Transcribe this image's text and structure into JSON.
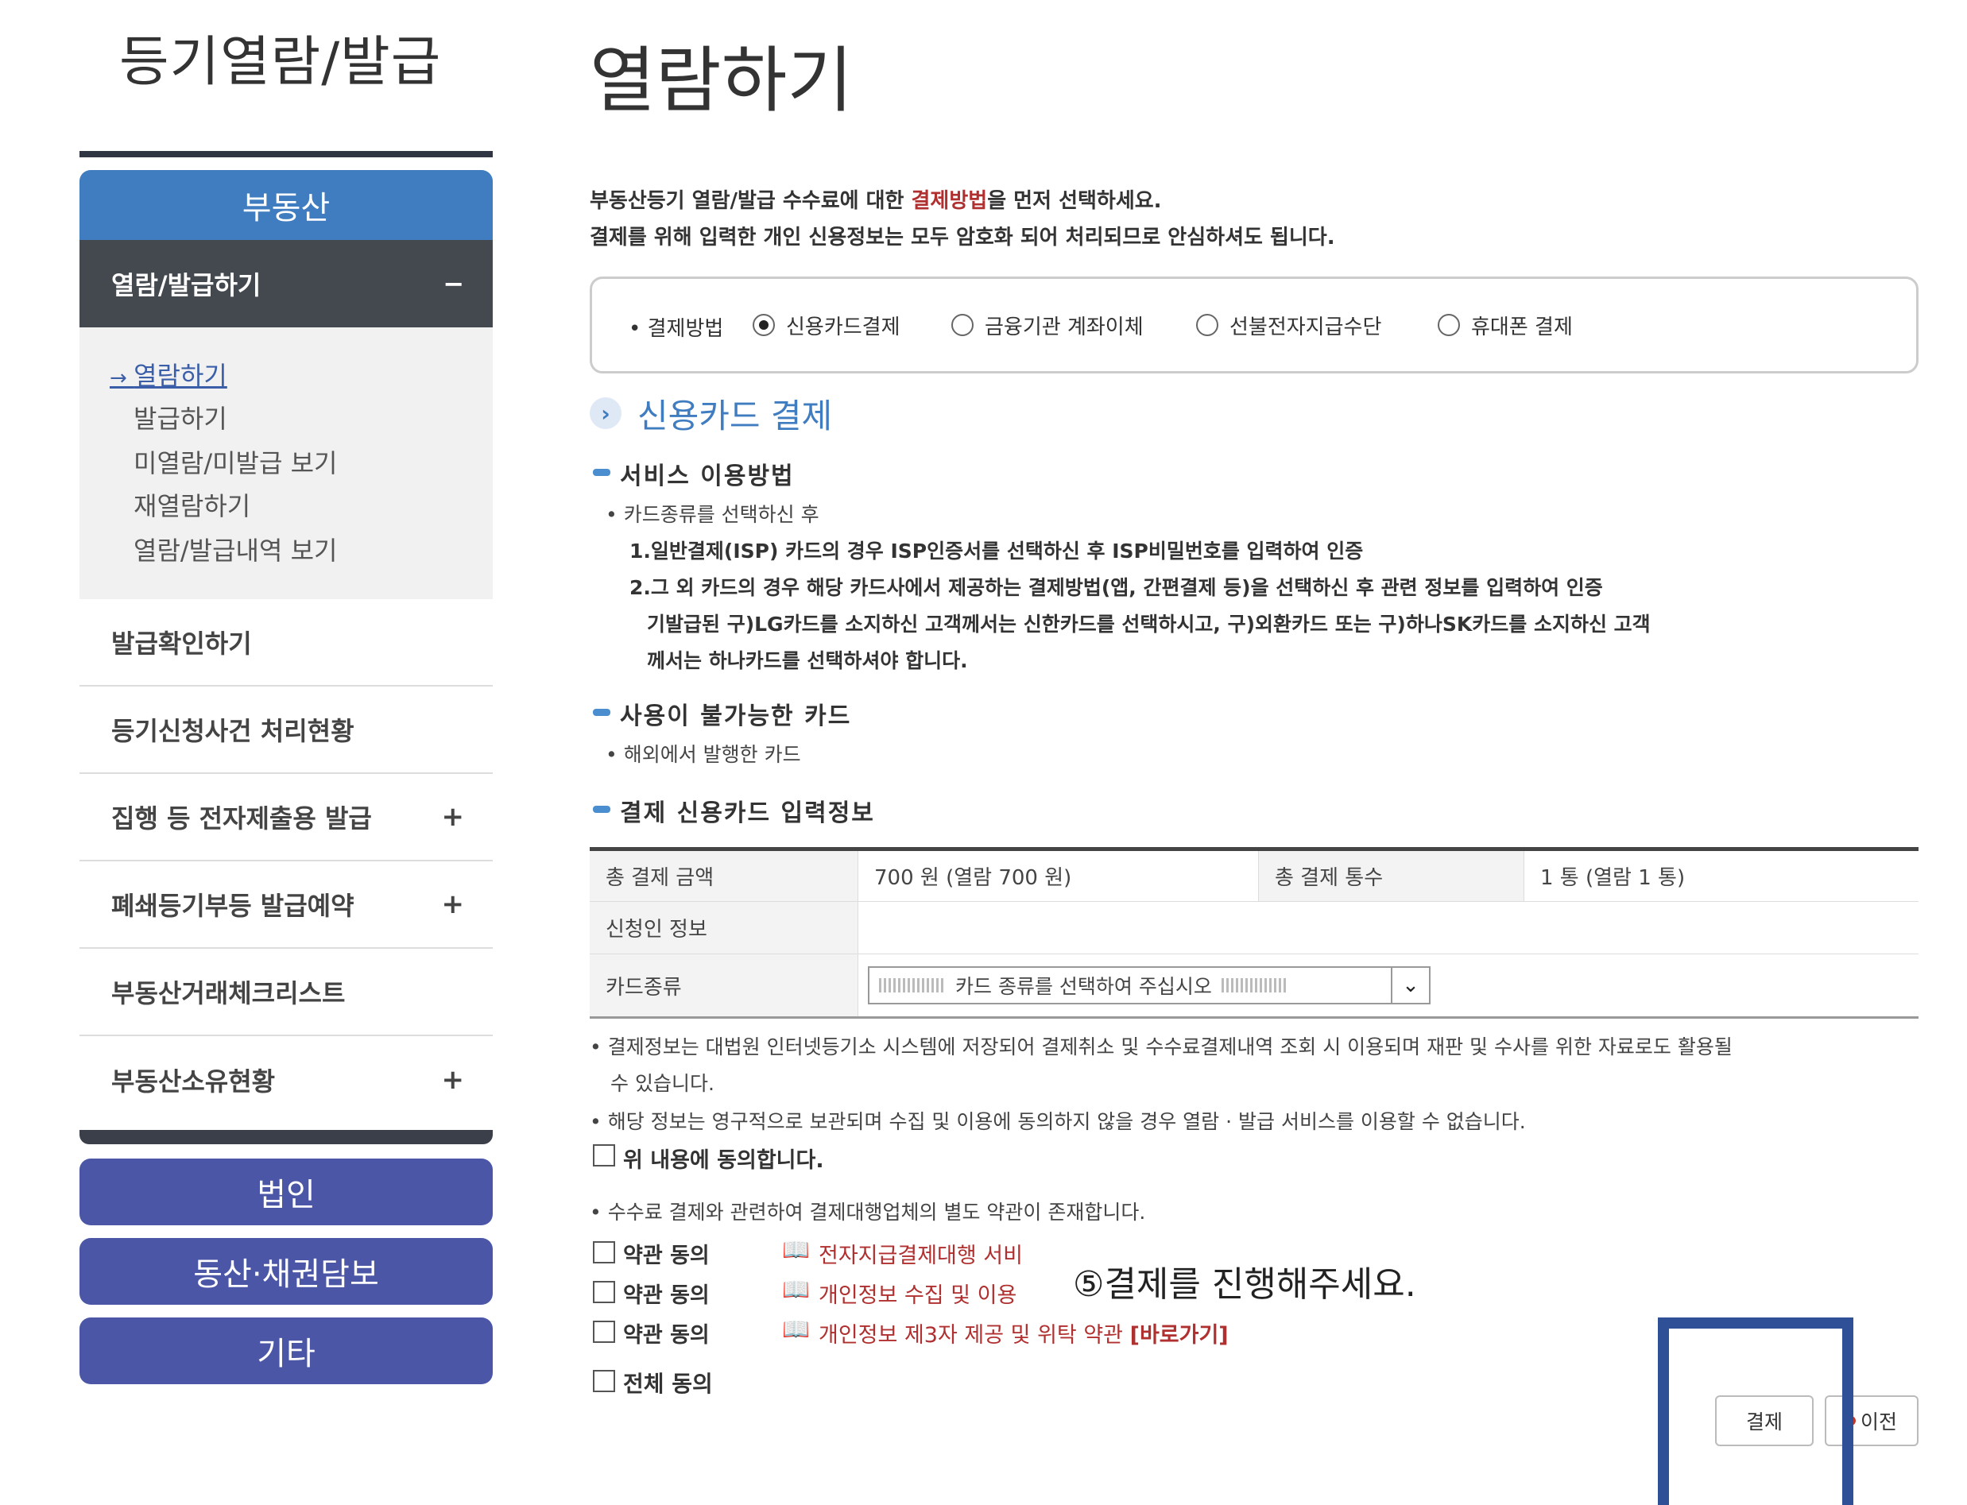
{
  "sidebar": {
    "title": "등기열람/발급",
    "section_header": "부동산",
    "open_menu": {
      "label": "열람/발급하기",
      "toggle": "−"
    },
    "sub_items": [
      "열람하기",
      "발급하기",
      "미열람/미발급 보기",
      "재열람하기",
      "열람/발급내역 보기"
    ],
    "rows": [
      {
        "label": "발급확인하기",
        "plus": ""
      },
      {
        "label": "등기신청사건 처리현황",
        "plus": ""
      },
      {
        "label": "집행 등 전자제출용 발급",
        "plus": "+"
      },
      {
        "label": "폐쇄등기부등 발급예약",
        "plus": "+"
      },
      {
        "label": "부동산거래체크리스트",
        "plus": ""
      },
      {
        "label": "부동산소유현황",
        "plus": "+"
      }
    ],
    "buttons": [
      "법인",
      "동산·채권담보",
      "기타"
    ]
  },
  "main": {
    "title": "열람하기",
    "intro_1_pre": "부동산등기 열람/발급 수수료에 대한 ",
    "intro_1_red": "결제방법",
    "intro_1_post": "을 먼저 선택하세요.",
    "intro_2": "결제를 위해 입력한 개인 신용정보는 모두 암호화 되어 처리되므로 안심하셔도 됩니다.",
    "payment": {
      "label": "• 결제방법",
      "options": [
        "신용카드결제",
        "금융기관 계좌이체",
        "선불전자지급수단",
        "휴대폰 결제"
      ],
      "selected": "신용카드결제"
    },
    "section_title": "신용카드 결제",
    "service": {
      "heading": "서비스 이용방법",
      "bullet": "• 카드종류를 선택하신 후",
      "step1": "1.일반결제(ISP) 카드의 경우 ISP인증서를 선택하신 후 ISP비밀번호를 입력하여 인증",
      "step2": "2.그 외 카드의 경우 해당 카드사에서 제공하는 결제방법(앱, 간편결제 등)을 선택하신 후 관련 정보를 입력하여 인증",
      "step2_line2": "기발급된 구)LG카드를 소지하신 고객께서는 신한카드를 선택하시고, 구)외환카드 또는 구)하나SK카드를 소지하신 고객",
      "step2_line3": "께서는 하나카드를 선택하셔야 합니다."
    },
    "unavailable": {
      "heading": "사용이 불가능한 카드",
      "bullet": "• 해외에서 발행한 카드"
    },
    "card_info": {
      "heading": "결제 신용카드 입력정보",
      "total_amount_label": "총 결제 금액",
      "total_amount_value": "700 원 (열람 700 원)",
      "total_count_label": "총 결제 통수",
      "total_count_value": "1 통 (열람 1 통)",
      "applicant_label": "신청인 정보",
      "card_type_label": "카드종류",
      "card_type_placeholder": "카드 종류를 선택하여 주십시오"
    },
    "notices": {
      "n1_line1": "• 결제정보는 대법원 인터넷등기소 시스템에 저장되어 결제취소 및 수수료결제내역 조회 시 이용되며 재판 및 수사를 위한 자료로도 활용될",
      "n1_line2": "수 있습니다.",
      "n2": "• 해당 정보는 영구적으로 보관되며 수집 및 이용에 동의하지 않을 경우 열람 · 발급 서비스를 이용할 수 없습니다.",
      "agree": "위 내용에 동의합니다.",
      "n3": "• 수수료 결제와 관련하여 결제대행업체의 별도 약관이 존재합니다."
    },
    "terms": [
      {
        "label": "약관 동의",
        "link": "전자지급결제대행 서비"
      },
      {
        "label": "약관 동의",
        "link": "개인정보 수집 및 이용"
      },
      {
        "label": "약관 동의",
        "link": "개인정보 제3자 제공 및 위탁 약관",
        "go": "[바로가기]"
      }
    ],
    "all_agree": "전체 동의",
    "callout": "⑤결제를 진행해주세요.",
    "buttons": {
      "pay": "결제",
      "prev": "이전"
    }
  },
  "colors": {
    "sidebar_blue": "#3f7cc0",
    "sidebar_dark": "#44484f",
    "sidebar_btn": "#4b57a6",
    "accent_red": "#b03030",
    "highlight": "#2f4f97"
  }
}
